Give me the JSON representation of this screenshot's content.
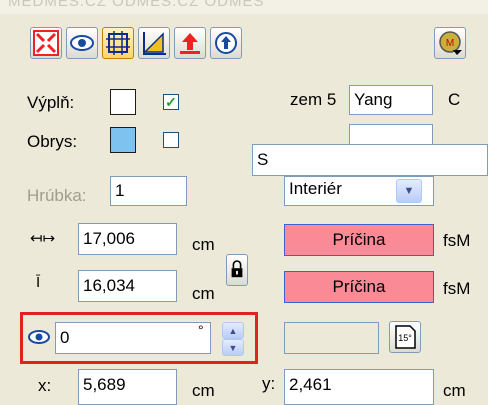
{
  "colors": {
    "accent_red": "#e22222",
    "pink_button": "#f98a96",
    "fill_swatch": "#ffffff",
    "outline_swatch": "#7ec3f0"
  },
  "toolbar": {
    "buttons": [
      {
        "icon": "shrink-arrows-icon"
      },
      {
        "icon": "eye-rotate-icon"
      },
      {
        "icon": "grid-frame-icon"
      },
      {
        "icon": "ruler-triangle-icon"
      },
      {
        "icon": "arrow-up-bar-icon"
      },
      {
        "icon": "circle-arrow-up-icon"
      }
    ],
    "right_button_icon": "macro-icon",
    "right_button_letter": "M"
  },
  "fill": {
    "label": "Výplň:",
    "checked": true,
    "check_glyph": "✓"
  },
  "outline": {
    "label": "Obrys:",
    "checked": false
  },
  "zem": {
    "label": "zem 5",
    "value": "Yang",
    "suffix": "C"
  },
  "popup_input": {
    "value": "S"
  },
  "thickness": {
    "label": "Hrúbka:",
    "value": "1"
  },
  "interior_select": {
    "value": "Interiér"
  },
  "width_row": {
    "value": "17,006",
    "unit": "cm",
    "button_label": "Príčina",
    "suffix": "fsM"
  },
  "height_row": {
    "value": "16,034",
    "unit": "cm",
    "button_label": "Príčina",
    "suffix": "fsM"
  },
  "rotation": {
    "value": "0",
    "unit": "°"
  },
  "rotate15_label": "15°",
  "coords": {
    "x_label": "x:",
    "x_value": "5,689",
    "x_unit": "cm",
    "y_label": "y:",
    "y_value": "2,461",
    "y_unit": "cm"
  },
  "watermark": "MEDMES.CZ ODMES.CZ ODMES"
}
